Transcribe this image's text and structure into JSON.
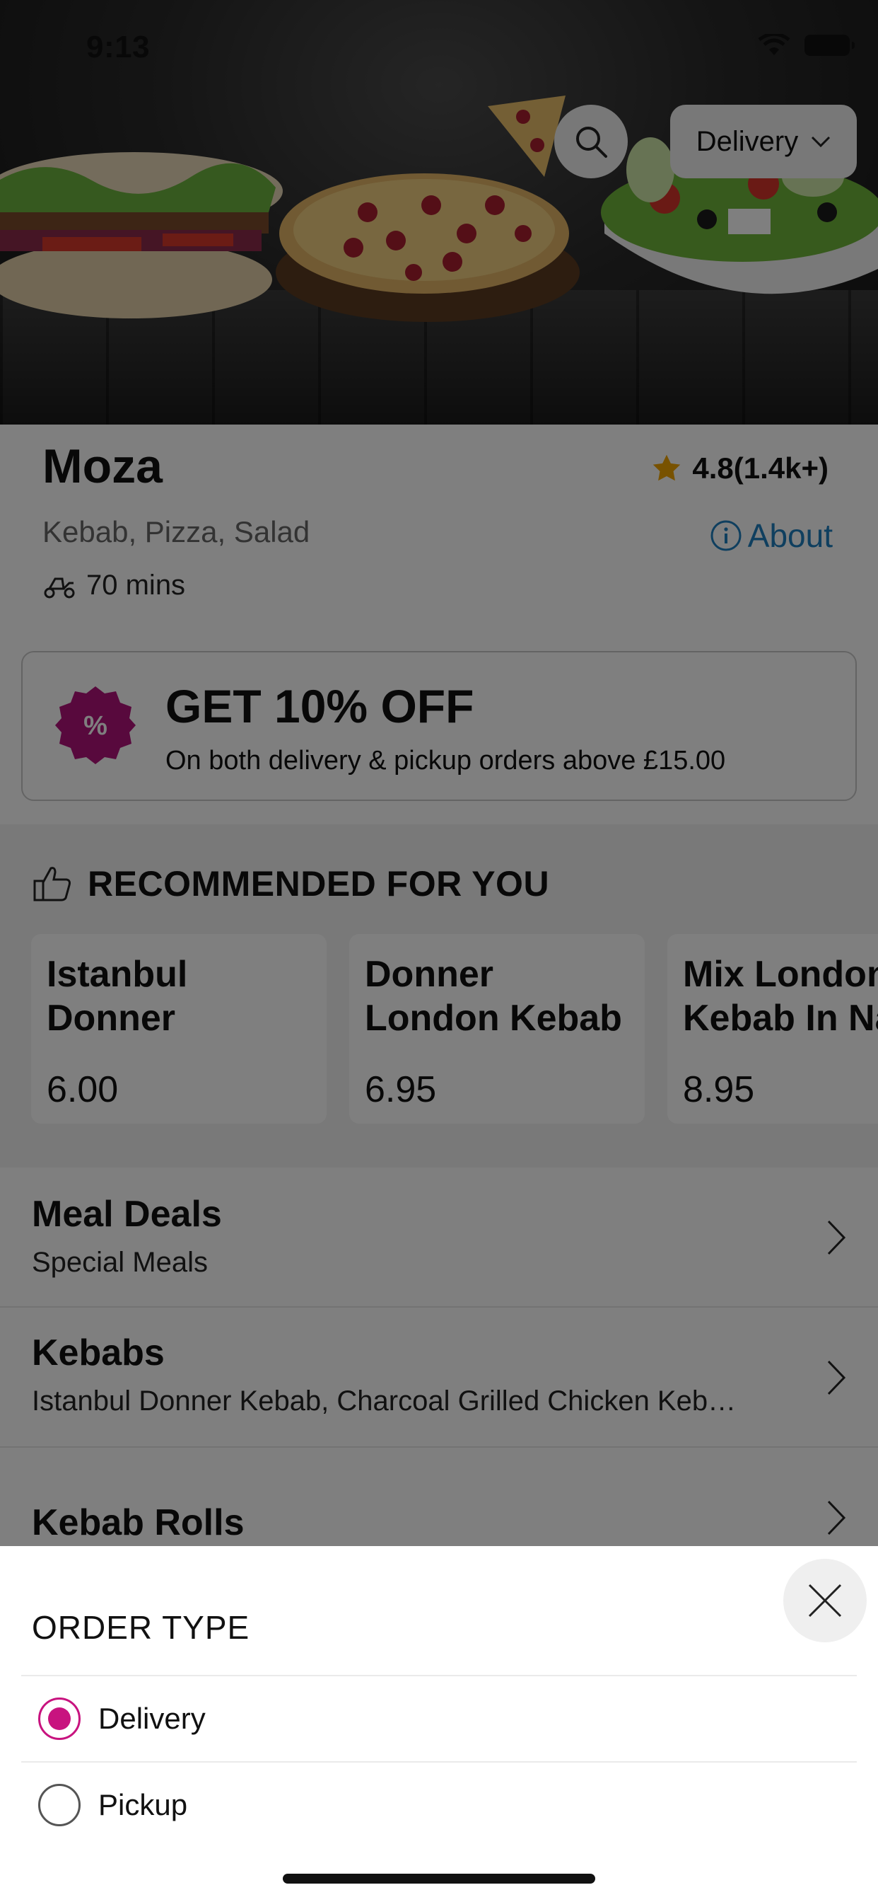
{
  "status_bar": {
    "time": "9:13"
  },
  "header": {
    "order_type_selected": "Delivery"
  },
  "restaurant": {
    "name": "Moza",
    "rating": "4.8(1.4k+)",
    "cuisines": "Kebab, Pizza, Salad",
    "about_label": "About",
    "delivery_time": "70 mins"
  },
  "offer": {
    "title": "GET 10% OFF",
    "subtitle": "On both delivery & pickup orders above £15.00"
  },
  "recommended": {
    "title": "RECOMMENDED FOR YOU",
    "items": [
      {
        "name": "Istanbul Donner Keba…",
        "price": "6.00"
      },
      {
        "name": "Donner London Kebab In Naan",
        "price": "6.95"
      },
      {
        "name": "Mix London Kebab In Na",
        "price": "8.95"
      }
    ]
  },
  "categories": [
    {
      "name": "Meal Deals",
      "description": "Special Meals"
    },
    {
      "name": "Kebabs",
      "description": "Istanbul Donner Kebab, Charcoal Grilled Chicken Keb…"
    },
    {
      "name": "Kebab Rolls",
      "description": ""
    }
  ],
  "order_type_sheet": {
    "title": "ORDER TYPE",
    "options": [
      {
        "label": "Delivery",
        "selected": true
      },
      {
        "label": "Pickup",
        "selected": false
      }
    ]
  },
  "colors": {
    "accent": "#c8137f",
    "link": "#1f7fbf",
    "star": "#f0a500"
  },
  "icons": {
    "search": "search-icon",
    "dropdown": "chevron-down-icon",
    "star": "star-icon",
    "about": "info-icon",
    "delivery_time": "scooter-icon",
    "offer": "discount-badge-icon",
    "recommended": "thumbs-up-icon",
    "category": "chevron-right-icon",
    "close": "close-icon"
  }
}
